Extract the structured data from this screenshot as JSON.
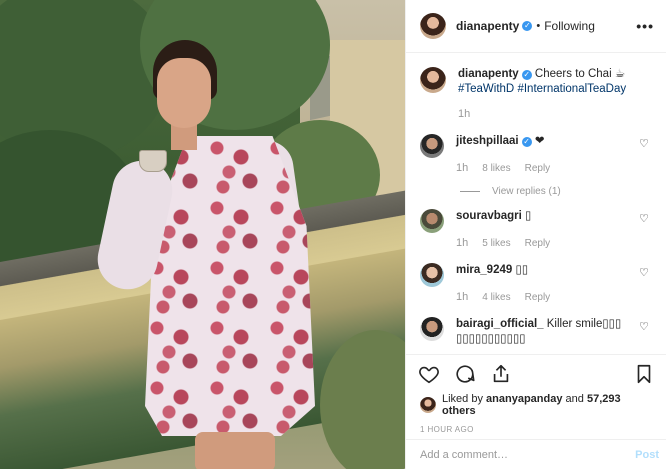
{
  "header": {
    "username": "dianapenty",
    "separator": "•",
    "follow_status": "Following",
    "more": "•••"
  },
  "caption": {
    "username": "dianapenty",
    "text": "Cheers to Chai ☕",
    "hashtags": [
      "#TeaWithD",
      "#InternationalTeaDay"
    ],
    "time": "1h"
  },
  "comments": [
    {
      "username": "jiteshpillaai",
      "verified": true,
      "text": "❤",
      "time": "1h",
      "likes": "8 likes",
      "reply": "Reply",
      "view_replies": "View replies (1)"
    },
    {
      "username": "souravbagri",
      "verified": false,
      "text": "▯",
      "time": "1h",
      "likes": "5 likes",
      "reply": "Reply"
    },
    {
      "username": "mira_9249",
      "verified": false,
      "text": "▯▯",
      "time": "1h",
      "likes": "4 likes",
      "reply": "Reply"
    },
    {
      "username": "bairagi_official_",
      "verified": false,
      "text": "Killer smile▯▯▯ ▯▯▯▯▯▯▯▯▯▯▯"
    }
  ],
  "likes": {
    "prefix": "Liked by",
    "user": "ananyapanday",
    "middle": "and",
    "count": "57,293 others"
  },
  "posted": "1 HOUR AGO",
  "add_comment": {
    "placeholder": "Add a comment…",
    "post_label": "Post"
  },
  "icons": [
    "heart-icon",
    "comment-icon",
    "share-icon",
    "bookmark-icon",
    "more-icon",
    "verified-icon"
  ],
  "colors": {
    "accent": "#3897f0",
    "hashtag": "#003569",
    "muted": "#999999",
    "post_disabled": "#b2dffc"
  }
}
